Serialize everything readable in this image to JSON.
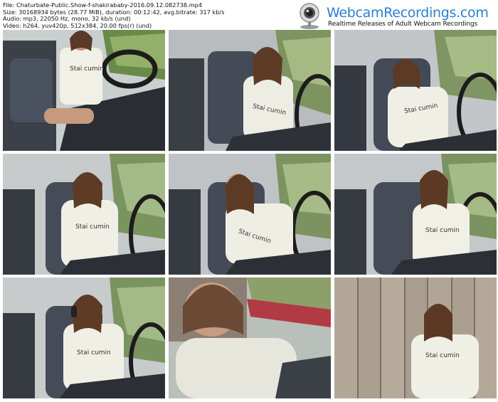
{
  "meta": {
    "file": "File: Chaturbate-Public.Show-f-shakirababy-2016.09.12.082738.mp4",
    "size": "Size: 30168934 bytes (28.77 MiB), duration: 00:12:42, avg.bitrate: 317 kb/s",
    "audio": "Audio: mp3, 22050 Hz, mono, 32 kb/s (und)",
    "video": "Video: h264, yuv420p, 512x384, 20.00 fps(r) (und)"
  },
  "logo": {
    "title": "WebcamRecordings.com",
    "subtitle": "Realtime Releases of Adult Webcam Recordings",
    "title_color": "#2a7fd4",
    "icon": "webcam-icon"
  },
  "thumbnails": [
    {
      "scene": "car-interior",
      "shirt_text": "Stai cumin"
    },
    {
      "scene": "car-interior",
      "shirt_text": "Stai cumin"
    },
    {
      "scene": "car-interior",
      "shirt_text": "Stai cumin"
    },
    {
      "scene": "car-interior",
      "shirt_text": "Stai cumin"
    },
    {
      "scene": "car-interior",
      "shirt_text": "Stai cumin"
    },
    {
      "scene": "car-interior",
      "shirt_text": "Stai cumin"
    },
    {
      "scene": "car-interior",
      "shirt_text": "Stai cumin"
    },
    {
      "scene": "car-interior-blurred",
      "shirt_text": ""
    },
    {
      "scene": "wooden-fence",
      "shirt_text": "Stai cumin"
    }
  ]
}
